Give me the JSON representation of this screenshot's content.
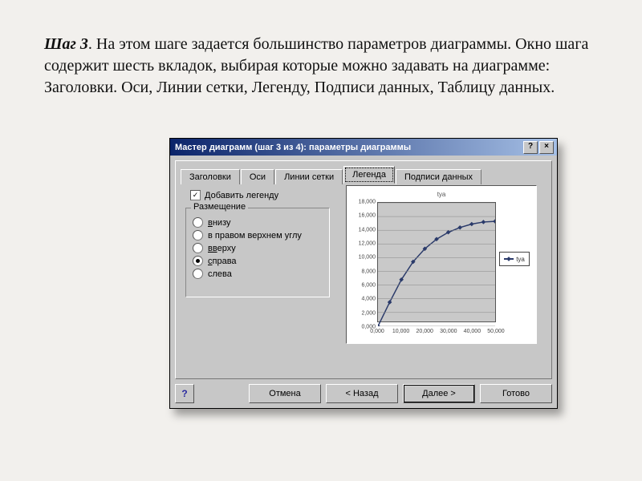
{
  "description": {
    "bold": "Шаг 3",
    "rest": ". На этом шаге задается большинство параметров диаграммы. Окно шага содержит шесть вкладок, выбирая которые можно задавать на диаграмме: Заголовки. Оси, Линии сетки, Легенду, Подписи данных, Таблицу данных."
  },
  "dialog": {
    "title": "Мастер диаграмм (шаг 3 из 4): параметры диаграммы",
    "help_btn": "?",
    "close_btn": "×",
    "tabs": [
      "Заголовки",
      "Оси",
      "Линии сетки",
      "Легенда",
      "Подписи данных"
    ],
    "active_tab": "Легенда",
    "add_legend_label": "Добавить легенду",
    "add_legend_checked": true,
    "placement_label": "Размещение",
    "placement_options": [
      {
        "label": "внизу",
        "underline": "в",
        "selected": false
      },
      {
        "label": "в правом верхнем углу",
        "underline": "",
        "selected": false
      },
      {
        "label": "вверху",
        "underline": "вв",
        "selected": false
      },
      {
        "label": "справа",
        "underline": "с",
        "selected": true
      },
      {
        "label": "слева",
        "underline": "",
        "selected": false
      }
    ],
    "buttons": {
      "help": "?",
      "cancel": "Отмена",
      "back": "< Назад",
      "next": "Далее >",
      "finish": "Готово"
    }
  },
  "chart_data": {
    "type": "line",
    "title": "tуа",
    "series_name": "tуа",
    "x": [
      0,
      5000,
      10000,
      15000,
      20000,
      25000,
      30000,
      35000,
      40000,
      45000,
      50000
    ],
    "y": [
      0,
      3500,
      6800,
      9400,
      11300,
      12700,
      13700,
      14400,
      14900,
      15200,
      15300
    ],
    "xlim": [
      0,
      50000
    ],
    "ylim": [
      0,
      18000
    ],
    "yticks": [
      0,
      2000,
      4000,
      6000,
      8000,
      10000,
      12000,
      14000,
      16000,
      18000
    ],
    "xticks": [
      0,
      10000,
      20000,
      30000,
      40000,
      50000
    ],
    "ytick_labels": [
      "0,000",
      "2,000",
      "4,000",
      "6,000",
      "8,000",
      "10,000",
      "12,000",
      "14,000",
      "16,000",
      "18,000"
    ],
    "xtick_labels": [
      "0,000",
      "10,000",
      "20,000",
      "30,000",
      "40,000",
      "50,000"
    ]
  }
}
